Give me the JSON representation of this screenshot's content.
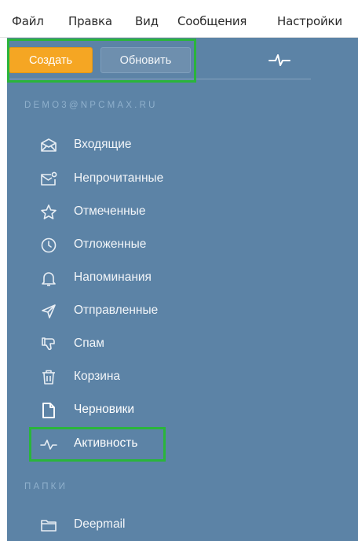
{
  "menubar": {
    "items": [
      "Файл",
      "Правка",
      "Вид",
      "Сообщения",
      "Настройки"
    ]
  },
  "toolbar": {
    "create_label": "Создать",
    "refresh_label": "Обновить",
    "activity_icon": "activity-pulse-icon"
  },
  "account": {
    "email": "DEMO3@NPCMAX.RU"
  },
  "nav": {
    "items": [
      {
        "label": "Входящие",
        "icon": "inbox-icon"
      },
      {
        "label": "Непрочитанные",
        "icon": "unread-mail-icon"
      },
      {
        "label": "Отмеченные",
        "icon": "star-icon"
      },
      {
        "label": "Отложенные",
        "icon": "clock-icon"
      },
      {
        "label": "Напоминания",
        "icon": "bell-icon"
      },
      {
        "label": "Отправленные",
        "icon": "send-icon"
      },
      {
        "label": "Спам",
        "icon": "thumbs-down-icon"
      },
      {
        "label": "Корзина",
        "icon": "trash-icon"
      },
      {
        "label": "Черновики",
        "icon": "draft-file-icon"
      },
      {
        "label": "Активность",
        "icon": "activity-pulse-icon"
      }
    ]
  },
  "folders": {
    "title": "ПАПКИ",
    "items": [
      {
        "label": "Deepmail",
        "icon": "folder-icon"
      }
    ]
  },
  "colors": {
    "sidebar_bg": "#5c83a6",
    "create_button": "#f5a623",
    "highlight": "#2ab53b"
  }
}
